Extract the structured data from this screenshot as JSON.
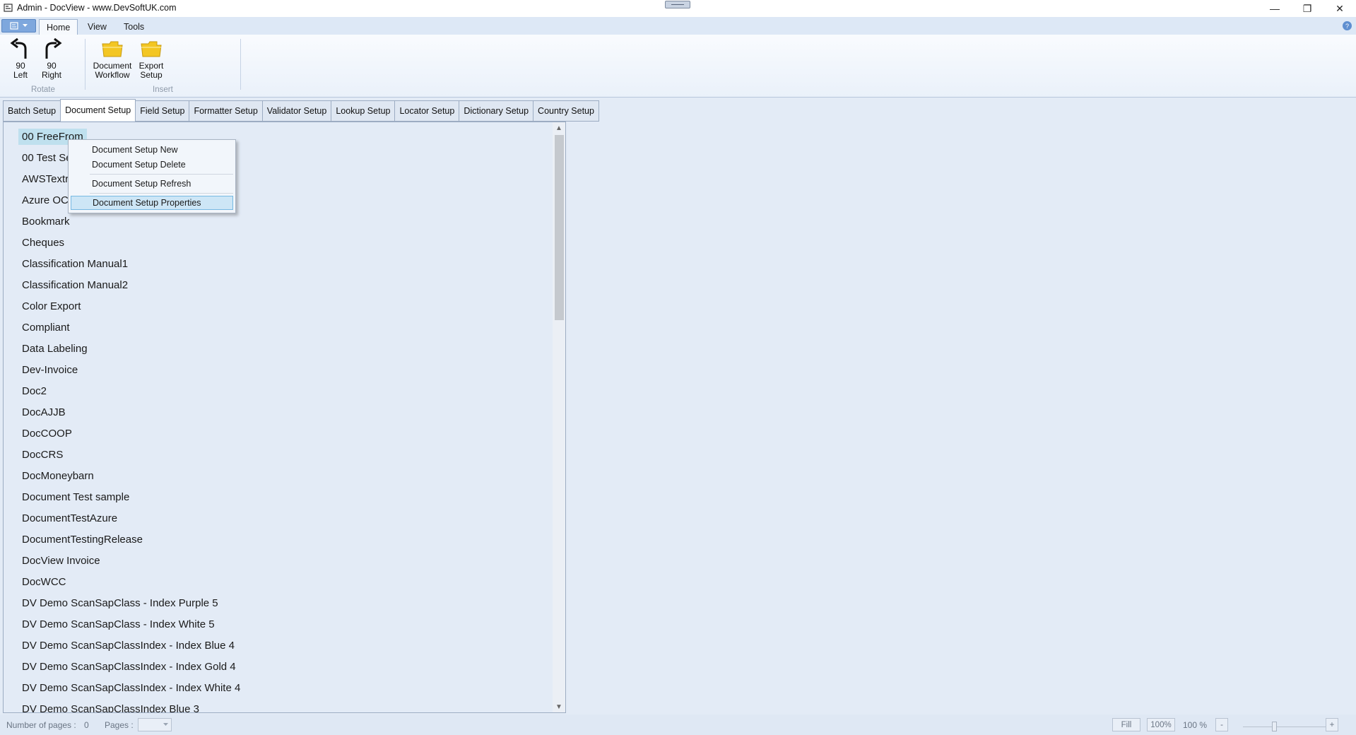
{
  "window": {
    "title": "Admin - DocView - www.DevSoftUK.com",
    "controls": {
      "minimize": "—",
      "restore": "❐",
      "close": "✕"
    }
  },
  "menu": {
    "tabs": [
      {
        "label": "Home",
        "active": true
      },
      {
        "label": "View",
        "active": false
      },
      {
        "label": "Tools",
        "active": false
      }
    ]
  },
  "ribbon": {
    "rotate_group": {
      "label": "Rotate",
      "buttons": [
        {
          "line1": "90",
          "line2": "Left",
          "icon": "rotate-left-icon"
        },
        {
          "line1": "90",
          "line2": "Right",
          "icon": "rotate-right-icon"
        }
      ]
    },
    "insert_group": {
      "label": "Insert",
      "buttons": [
        {
          "line1": "Document",
          "line2": "Workflow",
          "icon": "folder-icon"
        },
        {
          "line1": "Export",
          "line2": "Setup",
          "icon": "folder-icon"
        }
      ]
    }
  },
  "tabs": [
    {
      "label": "Batch Setup",
      "active": false
    },
    {
      "label": "Document Setup",
      "active": true
    },
    {
      "label": "Field Setup",
      "active": false
    },
    {
      "label": "Formatter Setup",
      "active": false
    },
    {
      "label": "Validator Setup",
      "active": false
    },
    {
      "label": "Lookup Setup",
      "active": false
    },
    {
      "label": "Locator Setup",
      "active": false
    },
    {
      "label": "Dictionary Setup",
      "active": false
    },
    {
      "label": "Country Setup",
      "active": false
    }
  ],
  "document_list": {
    "selected_index": 0,
    "items": [
      "00 FreeFrom",
      "00 Test Se",
      "AWSTextra",
      "Azure OC",
      "Bookmark",
      "Cheques",
      "Classification Manual1",
      "Classification Manual2",
      "Color Export",
      "Compliant",
      "Data Labeling",
      "Dev-Invoice",
      "Doc2",
      "DocAJJB",
      "DocCOOP",
      "DocCRS",
      "DocMoneybarn",
      "Document Test sample",
      "DocumentTestAzure",
      "DocumentTestingRelease",
      "DocView Invoice",
      "DocWCC",
      "DV Demo ScanSapClass - Index Purple 5",
      "DV Demo ScanSapClass - Index White 5",
      "DV Demo ScanSapClassIndex - Index  Blue 4",
      "DV Demo ScanSapClassIndex - Index  Gold 4",
      "DV Demo ScanSapClassIndex - Index  White 4",
      "DV Demo ScanSapClassIndex Blue 3"
    ]
  },
  "context_menu": {
    "items": [
      {
        "label": "Document Setup New",
        "highlighted": false
      },
      {
        "label": "Document Setup Delete",
        "highlighted": false
      },
      {
        "label": "Document Setup Refresh",
        "highlighted": false
      },
      {
        "label": "Document Setup Properties",
        "highlighted": true
      }
    ]
  },
  "status": {
    "pages_count_label": "Number of pages :",
    "pages_count_value": "0",
    "pages_label": "Pages :",
    "fill_label": "Fill",
    "zoom_100_label": "100%",
    "zoom_value": "100 %",
    "zoom_out": "-",
    "zoom_in": "+"
  },
  "colors": {
    "background": "#e3ebf6",
    "selection": "#bfe0ee",
    "context_highlight": "#cde6f6",
    "folder": "#f3c623"
  }
}
